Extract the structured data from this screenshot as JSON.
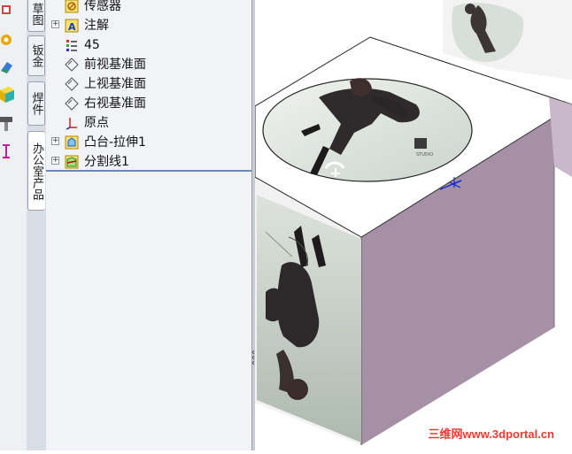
{
  "side_tabs": [
    "草图",
    "钣金",
    "焊件",
    "办公室产品"
  ],
  "feature_tree": [
    {
      "label": "传感器",
      "icon": "sensor-icon",
      "expand": false
    },
    {
      "label": "注解",
      "icon": "annotation-icon",
      "expand": true
    },
    {
      "label": "45",
      "icon": "material-icon",
      "expand": false
    },
    {
      "label": "前视基准面",
      "icon": "plane-icon",
      "expand": false
    },
    {
      "label": "上视基准面",
      "icon": "plane-icon",
      "expand": false
    },
    {
      "label": "右视基准面",
      "icon": "plane-icon",
      "expand": false
    },
    {
      "label": "原点",
      "icon": "origin-icon",
      "expand": false
    },
    {
      "label": "凸台-拉伸1",
      "icon": "extrude-icon",
      "expand": true
    },
    {
      "label": "分割线1",
      "icon": "split-line-icon",
      "expand": true
    }
  ],
  "watermark": "三维网www.3dportal.cn",
  "colors": {
    "cube_right": "#a590a6",
    "tree_bg": "#f1f3f6",
    "separator": "#6a88b8"
  }
}
